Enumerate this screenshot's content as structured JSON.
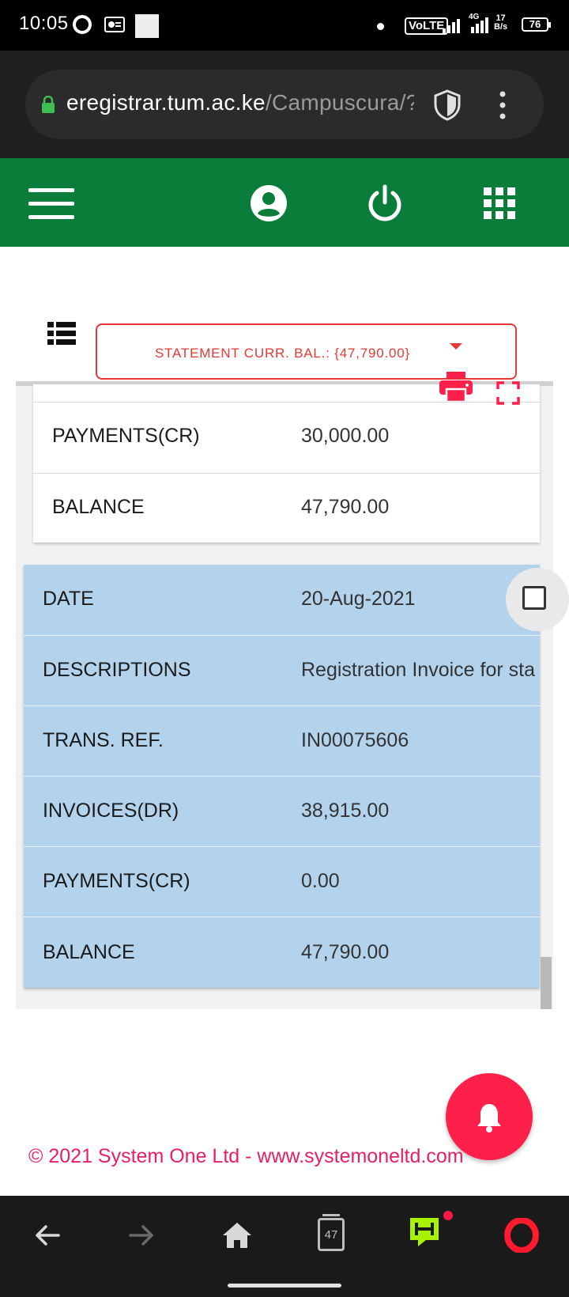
{
  "status_bar": {
    "time": "10:05",
    "volte": "VoLTE",
    "network": "4G",
    "speed_value": "17",
    "speed_unit": "B/s",
    "battery": "76"
  },
  "browser": {
    "url_host": "eregistrar.tum.ac.ke",
    "url_path": "/Campuscura/?"
  },
  "statement": {
    "selected_label": "STATEMENT CURR. BAL.: {47,790.00}"
  },
  "previous_entry": {
    "rows": [
      {
        "label": "PAYMENTS(CR)",
        "value": "30,000.00"
      },
      {
        "label": "BALANCE",
        "value": "47,790.00"
      }
    ]
  },
  "current_entry": {
    "rows": [
      {
        "label": "DATE",
        "value": "20-Aug-2021"
      },
      {
        "label": "DESCRIPTIONS",
        "value": "Registration Invoice for sta"
      },
      {
        "label": "TRANS. REF.",
        "value": "IN00075606"
      },
      {
        "label": "INVOICES(DR)",
        "value": "38,915.00"
      },
      {
        "label": "PAYMENTS(CR)",
        "value": "0.00"
      },
      {
        "label": "BALANCE",
        "value": "47,790.00"
      }
    ]
  },
  "footer": {
    "copyright": "© 2021 System One Ltd - www.systemoneltd.com"
  },
  "bottom_nav": {
    "tabs_count": "47"
  },
  "colors": {
    "header_green": "#0a7d3b",
    "accent_red": "#e53935",
    "row_blue": "#b3d3ec",
    "fab_pink": "#ff1f4b",
    "footer_pink": "#e91e63"
  },
  "icons": {
    "status": [
      "opera-icon",
      "radio-icon"
    ],
    "browser": [
      "lock-icon",
      "shield-icon",
      "menu-dots-icon"
    ],
    "header": [
      "hamburger-icon",
      "user-icon",
      "power-icon",
      "grid-icon"
    ],
    "table": [
      "list-icon",
      "print-icon",
      "fullscreen-icon",
      "checkbox-icon"
    ],
    "nav": [
      "back-icon",
      "forward-icon",
      "home-icon",
      "tabs-icon",
      "flow-icon",
      "opera-icon"
    ]
  }
}
